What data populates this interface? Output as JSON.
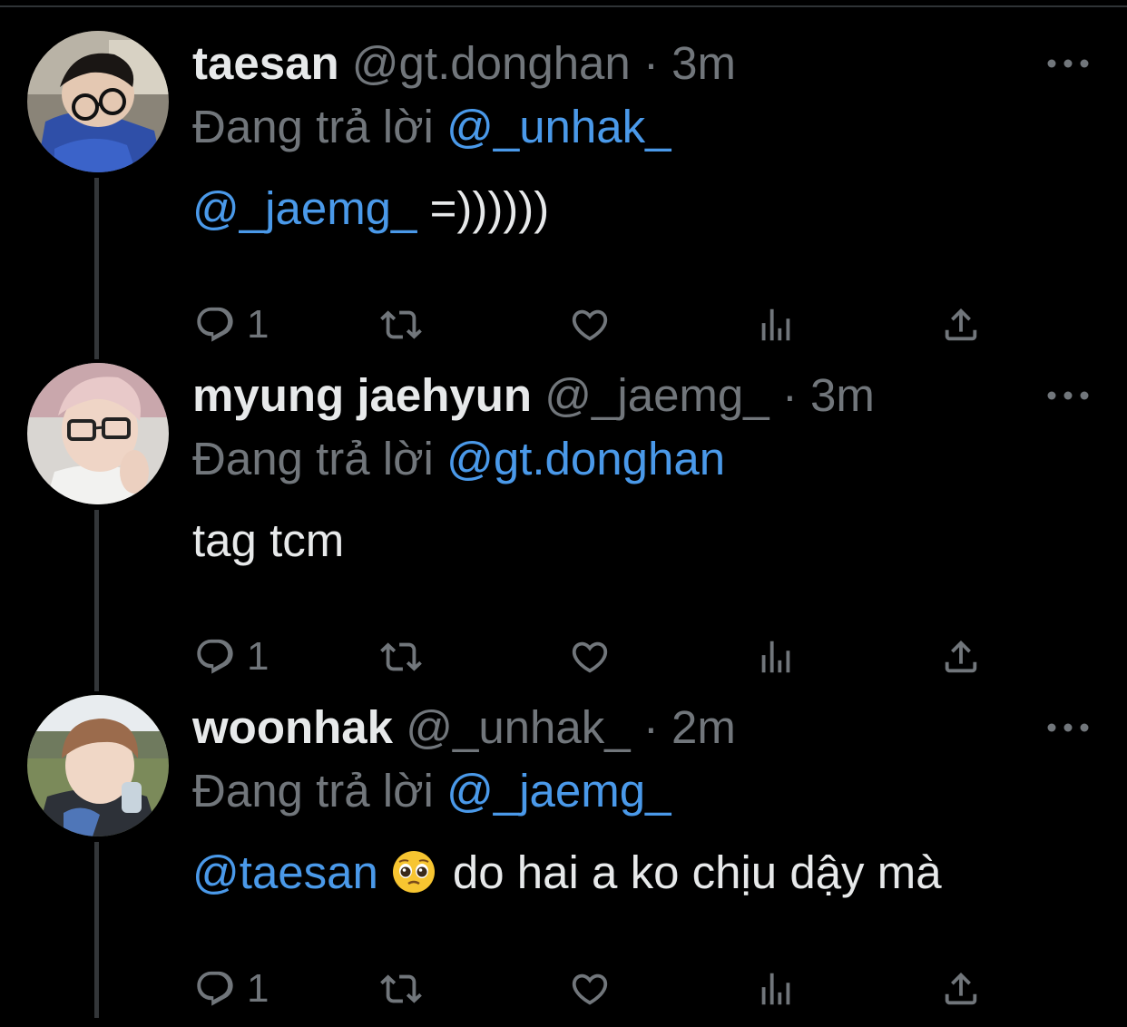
{
  "theme": {
    "background": "#000000",
    "text": "#e7e9ea",
    "muted": "#71767b",
    "link": "#4a99e9",
    "thread_line": "#333639"
  },
  "reply_prefix": "Đang trả lời",
  "tweets": [
    {
      "display_name": "taesan",
      "handle": "@gt.donghan",
      "separator": "·",
      "time": "3m",
      "replying_to": "@_unhak_",
      "body_mention": "@_jaemg_",
      "body_text": "=))))))",
      "reply_count": "1",
      "avatar": "avatar-taesan"
    },
    {
      "display_name": "myung jaehyun",
      "handle": "@_jaemg_",
      "separator": "·",
      "time": "3m",
      "replying_to": "@gt.donghan",
      "body_text": "tag tcm",
      "reply_count": "1",
      "avatar": "avatar-jaehyun"
    },
    {
      "display_name": "woonhak",
      "handle": "@_unhak_",
      "separator": "·",
      "time": "2m",
      "replying_to": "@_jaemg_",
      "body_mention": "@taesan",
      "body_emoji": "pleading-face-emoji",
      "body_text": "do hai a ko chịu dậy mà",
      "reply_count": "1",
      "avatar": "avatar-woonhak"
    }
  ],
  "icons": {
    "reply": "reply-icon",
    "retweet": "retweet-icon",
    "like": "heart-icon",
    "views": "views-icon",
    "share": "share-icon",
    "more": "more-icon"
  }
}
